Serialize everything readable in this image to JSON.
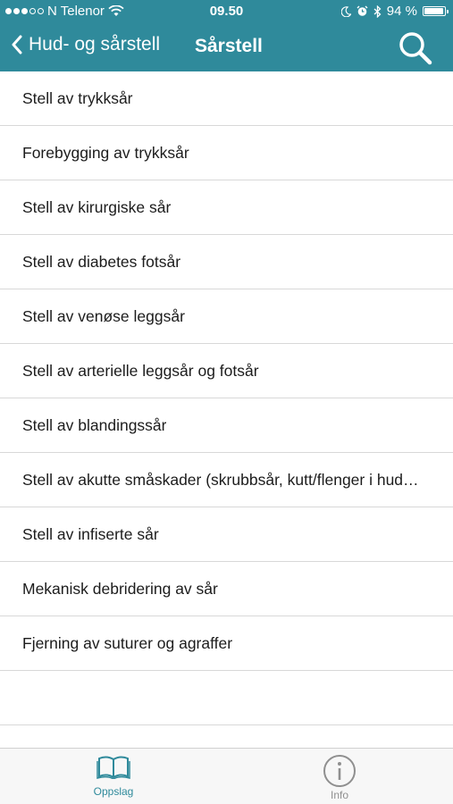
{
  "status_bar": {
    "carrier": "N Telenor",
    "time": "09.50",
    "battery_text": "94 %",
    "battery_level": 0.94,
    "icons": [
      "signal-dots",
      "wifi-icon",
      "moon-icon",
      "alarm-icon",
      "bluetooth-icon",
      "battery-icon"
    ]
  },
  "nav": {
    "back_label": "Hud- og sårstell",
    "title": "Sårstell",
    "search_icon": "search-icon"
  },
  "list": {
    "items": [
      "Stell av trykksår",
      "Forebygging av trykksår",
      "Stell av kirurgiske sår",
      "Stell av diabetes fotsår",
      "Stell av venøse leggsår",
      "Stell av arterielle leggsår og fotsår",
      "Stell av blandingssår",
      "Stell av akutte småskader (skrubbsår, kutt/flenger i hud…",
      "Stell av infiserte sår",
      "Mekanisk debridering av sår",
      "Fjerning av suturer og agraffer"
    ]
  },
  "tabs": {
    "oppslag": {
      "label": "Oppslag",
      "icon": "book-icon",
      "active": true
    },
    "info": {
      "label": "Info",
      "icon": "info-icon",
      "active": false
    }
  },
  "colors": {
    "header": "#2f8a9b",
    "accent": "#2f8a9b",
    "divider": "#d8d8d8",
    "inactive_tab": "#8f8f8f"
  }
}
